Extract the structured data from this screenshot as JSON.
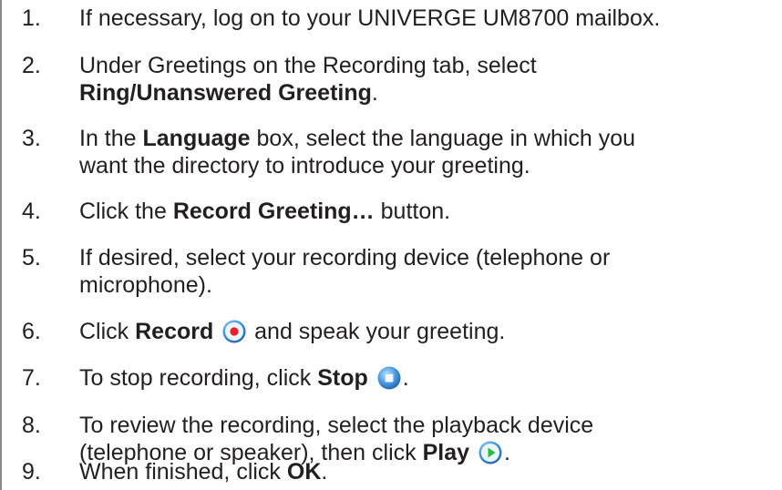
{
  "steps": [
    {
      "num": "1.",
      "a": "If necessary, log on to your UNIVERGE UM8700 mailbox."
    },
    {
      "num": "2.",
      "a": "Under Greetings on the Recording tab, select",
      "b": "Ring/Unanswered Greeting",
      "c": "."
    },
    {
      "num": "3.",
      "a": "In the ",
      "b": "Language",
      "c": " box, select the language in which you",
      "d": "want the directory to introduce your greeting."
    },
    {
      "num": "4.",
      "a": "Click the ",
      "b": "Record Greeting…",
      "c": " button."
    },
    {
      "num": "5.",
      "a": "If desired, select your recording device (telephone or",
      "b": "microphone)."
    },
    {
      "num": "6.",
      "a": "Click ",
      "b": "Record",
      "c": " and speak your greeting."
    },
    {
      "num": "7.",
      "a": "To stop recording, click ",
      "b": "Stop",
      "c": "."
    },
    {
      "num": "8.",
      "a": "To review the recording, select the playback device",
      "b": "(telephone or speaker), then click ",
      "c": "Play",
      "d": "."
    },
    {
      "num": "9.",
      "a": "When finished, click ",
      "b": "OK",
      "c": "."
    }
  ],
  "icons": {
    "record": "record-icon",
    "stop": "stop-icon",
    "play": "play-icon"
  },
  "colors": {
    "text": "#231f20",
    "icon_blue": "#3f8fd8",
    "record_red": "#e8202a",
    "play_green": "#2dbb3a"
  }
}
